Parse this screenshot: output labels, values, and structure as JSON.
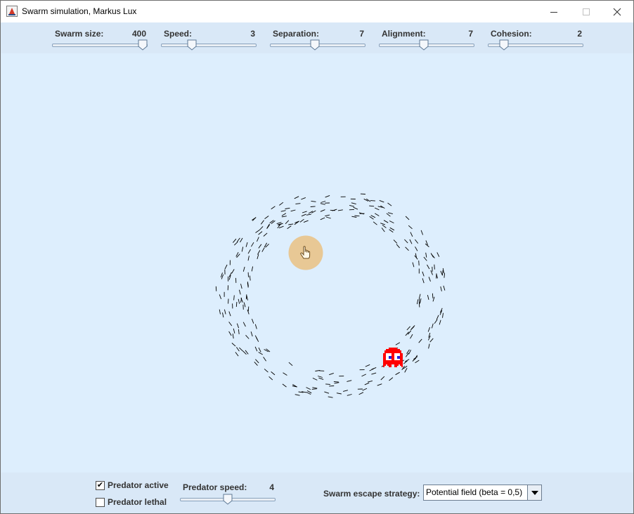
{
  "window": {
    "title": "Swarm simulation, Markus Lux",
    "app_icon": "java-app-icon",
    "controls": [
      "minimize-icon",
      "maximize-icon",
      "close-icon"
    ]
  },
  "top_controls": {
    "swarm_size": {
      "label": "Swarm size:",
      "value": "400",
      "level": 1.0
    },
    "speed": {
      "label": "Speed:",
      "value": "3",
      "level": 0.3
    },
    "separation": {
      "label": "Separation:",
      "value": "7",
      "level": 0.47
    },
    "alignment": {
      "label": "Alignment:",
      "value": "7",
      "level": 0.47
    },
    "cohesion": {
      "label": "Cohesion:",
      "value": "2",
      "level": 0.13
    }
  },
  "simulation": {
    "predator_icon": "red-ghost-predator",
    "cursor_icon": "hand-pointer-icon",
    "background_color": "#ddeefd",
    "predator_color": "#ff0000",
    "boid_color": "#000000"
  },
  "bottom_controls": {
    "predator_active": {
      "label": "Predator active",
      "checked": true
    },
    "predator_lethal": {
      "label": "Predator lethal",
      "checked": false
    },
    "predator_speed": {
      "label": "Predator speed:",
      "value": "4",
      "level": 0.5
    },
    "escape_strategy": {
      "label": "Swarm escape strategy:",
      "selected": "Potential field (beta = 0,5)"
    }
  }
}
